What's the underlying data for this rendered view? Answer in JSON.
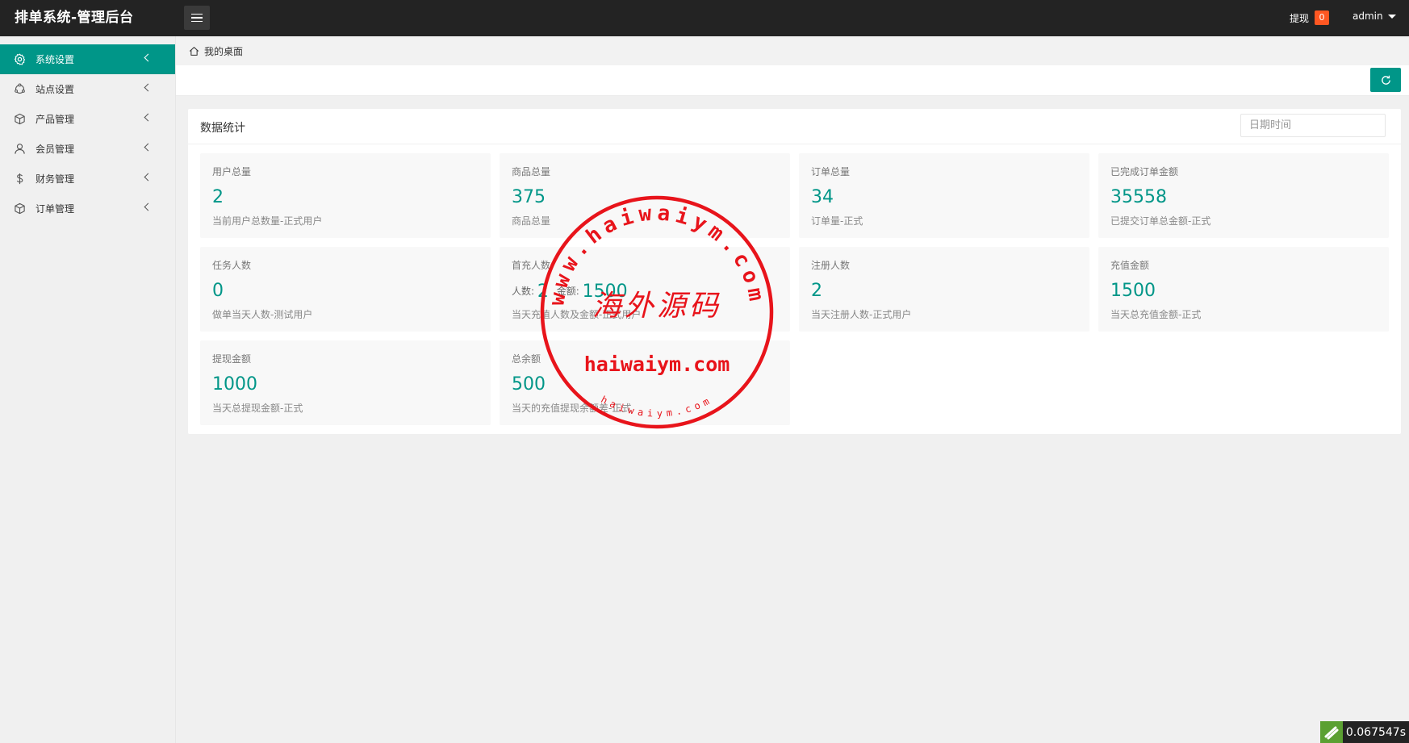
{
  "header": {
    "title": "排单系统-管理后台",
    "withdraw_label": "提现",
    "withdraw_count": "0",
    "user": "admin"
  },
  "sidebar": {
    "items": [
      {
        "label": "系统设置",
        "icon": "gear-icon",
        "active": true
      },
      {
        "label": "站点设置",
        "icon": "site-icon",
        "active": false
      },
      {
        "label": "产品管理",
        "icon": "box-icon",
        "active": false
      },
      {
        "label": "会员管理",
        "icon": "user-icon",
        "active": false
      },
      {
        "label": "财务管理",
        "icon": "dollar-icon",
        "active": false
      },
      {
        "label": "订单管理",
        "icon": "box-icon",
        "active": false
      }
    ]
  },
  "breadcrumb": {
    "home": "我的桌面"
  },
  "stats_card": {
    "title": "数据统计",
    "date_placeholder": "日期时间",
    "items": [
      {
        "label": "用户总量",
        "value": "2",
        "desc": "当前用户总数量-正式用户"
      },
      {
        "label": "商品总量",
        "value": "375",
        "desc": "商品总量"
      },
      {
        "label": "订单总量",
        "value": "34",
        "desc": "订单量-正式"
      },
      {
        "label": "已完成订单金额",
        "value": "35558",
        "desc": "已提交订单总金额-正式"
      },
      {
        "label": "任务人数",
        "value": "0",
        "desc": "做单当天人数-测试用户"
      },
      {
        "label": "首充人数",
        "people_label": "人数:",
        "people_value": "2",
        "amount_label": "金额:",
        "amount_value": "1500",
        "desc": "当天充值人数及金额-正式用户"
      },
      {
        "label": "注册人数",
        "value": "2",
        "desc": "当天注册人数-正式用户"
      },
      {
        "label": "充值金额",
        "value": "1500",
        "desc": "当天总充值金额-正式"
      },
      {
        "label": "提现金额",
        "value": "1000",
        "desc": "当天总提现金额-正式"
      },
      {
        "label": "总余额",
        "value": "500",
        "desc": "当天的充值提现余额差-正式"
      }
    ]
  },
  "watermark": {
    "ring_text": "www.haiwaiym.com",
    "center_text": "海外源码",
    "domain_text": "haiwaiym.com",
    "small_text": "haiwaiym.com",
    "color": "#e8141b"
  },
  "timer": {
    "value": "0.067547s"
  },
  "colors": {
    "accent": "#009688",
    "topbar": "#232323",
    "badge": "#ff5722"
  }
}
